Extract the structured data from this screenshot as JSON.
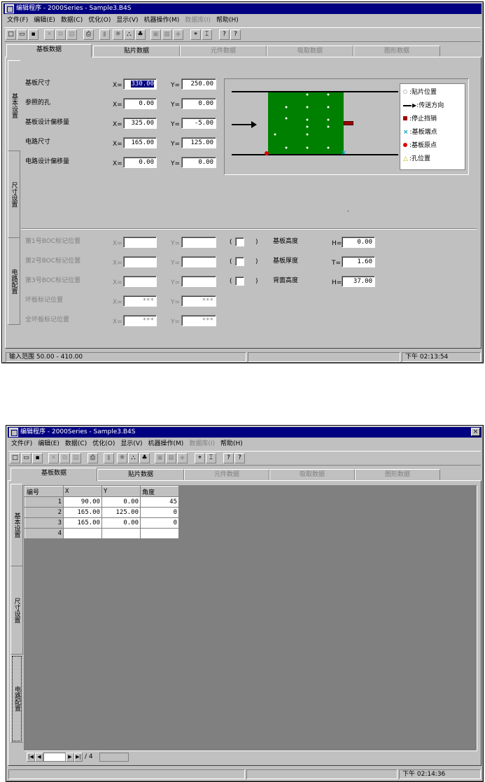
{
  "window1": {
    "title": "编辑程序 - 2000Series - Sample3.B4S",
    "menus": [
      {
        "label": "文件(F)",
        "enabled": true
      },
      {
        "label": "编辑(E)",
        "enabled": true
      },
      {
        "label": "数据(C)",
        "enabled": true
      },
      {
        "label": "优化(O)",
        "enabled": true
      },
      {
        "label": "显示(V)",
        "enabled": true
      },
      {
        "label": "机器操作(M)",
        "enabled": true
      },
      {
        "label": "数据库(I)",
        "enabled": false
      },
      {
        "label": "帮助(H)",
        "enabled": true
      }
    ],
    "tabs": [
      "基板数据",
      "贴片数据",
      "元件数据",
      "吸取数据",
      "图形数据"
    ],
    "side_tabs": [
      "基本设置",
      "尺寸设置",
      "电路配置"
    ],
    "rows": [
      {
        "label": "基板尺寸",
        "x": "330.00",
        "y": "250.00"
      },
      {
        "label": "参照的孔",
        "x": "0.00",
        "y": "0.00"
      },
      {
        "label": "基板设计偏移量",
        "x": "325.00",
        "y": "-5.00"
      },
      {
        "label": "电路尺寸",
        "x": "165.00",
        "y": "125.00"
      },
      {
        "label": "电路设计偏移量",
        "x": "0.00",
        "y": "0.00"
      }
    ],
    "x_prefix": "X=",
    "y_prefix": "Y=",
    "legend": [
      {
        "label": ":贴片位置",
        "icon": "white-dot-icon"
      },
      {
        "label": ":传送方向",
        "icon": "arrow-right-icon"
      },
      {
        "label": ":停止挡销",
        "icon": "stopper-icon"
      },
      {
        "label": ":基板端点",
        "icon": "x-mark-icon"
      },
      {
        "label": ":基板原点",
        "icon": "red-dot-icon"
      },
      {
        "label": ":孔位置",
        "icon": "triangle-icon"
      }
    ],
    "lower_rows": [
      {
        "label": "第1号BOC标记位置",
        "x": "",
        "y": ""
      },
      {
        "label": "第2号BOC标记位置",
        "x": "",
        "y": ""
      },
      {
        "label": "第3号BOC标记位置",
        "x": "",
        "y": ""
      },
      {
        "label": "坏板标记位置",
        "x": "***",
        "y": "***"
      },
      {
        "label": "全坏板标记位置",
        "x": "***",
        "y": "***"
      }
    ],
    "paren_open": "(",
    "paren_close": ")",
    "heights": [
      {
        "label": "基板高度",
        "prefix": "H=",
        "value": "0.00"
      },
      {
        "label": "基板厚度",
        "prefix": "T=",
        "value": "1.60"
      },
      {
        "label": "背面高度",
        "prefix": "H=",
        "value": "37.00"
      }
    ],
    "status": {
      "range": "输入范围  50.00 - 410.00",
      "middle": "",
      "time": "下午 02:13:54"
    },
    "colors": {
      "board": "#008000",
      "title": "#000080"
    }
  },
  "window2": {
    "title": "编辑程序 - 2000Series - Sample3.B4S",
    "close": "×",
    "menus": [
      {
        "label": "文件(F)",
        "enabled": true
      },
      {
        "label": "编辑(E)",
        "enabled": true
      },
      {
        "label": "数据(C)",
        "enabled": true
      },
      {
        "label": "优化(O)",
        "enabled": true
      },
      {
        "label": "显示(V)",
        "enabled": true
      },
      {
        "label": "机器操作(M)",
        "enabled": true
      },
      {
        "label": "数据库(I)",
        "enabled": false
      },
      {
        "label": "帮助(H)",
        "enabled": true
      }
    ],
    "tabs": [
      "基板数据",
      "贴片数据",
      "元件数据",
      "吸取数据",
      "图形数据"
    ],
    "side_tabs": [
      "基本设置",
      "尺寸设置",
      "电路配置"
    ],
    "grid": {
      "headers": [
        "编号",
        "X",
        "Y",
        "角度"
      ],
      "rows": [
        [
          "1",
          "90.00",
          "0.00",
          "45"
        ],
        [
          "2",
          "165.00",
          "125.00",
          "0"
        ],
        [
          "3",
          "165.00",
          "0.00",
          "0"
        ],
        [
          "4",
          "",
          "",
          ""
        ]
      ]
    },
    "nav_count": "/ 4",
    "status": {
      "left": "",
      "middle": "",
      "time": "下午 02:14:36"
    }
  }
}
